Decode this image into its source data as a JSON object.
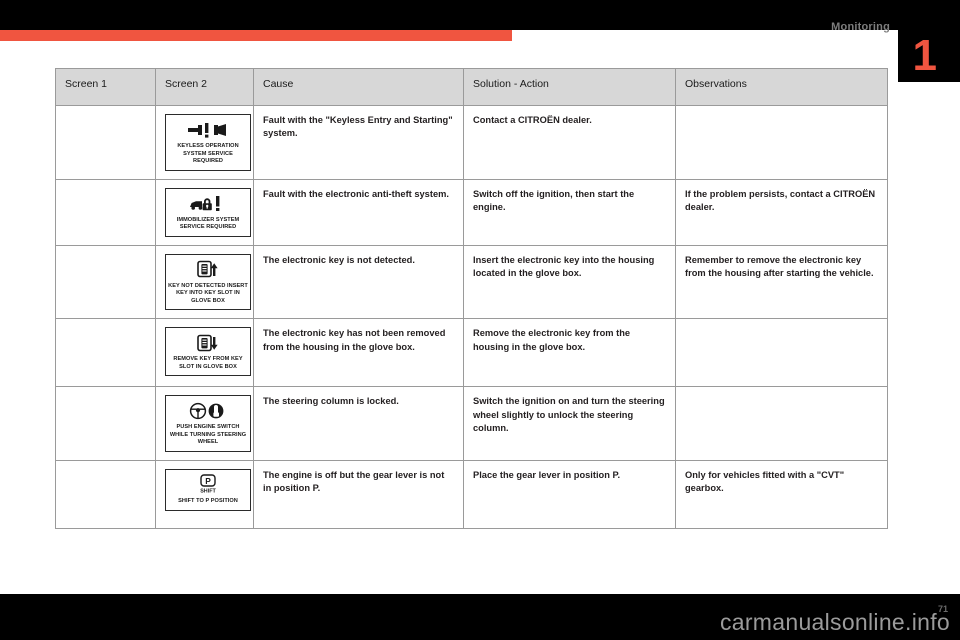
{
  "header": {
    "section_title": "Monitoring",
    "chapter_number": "1",
    "accent_color": "#f05540"
  },
  "footer": {
    "watermark": "carmanualsonline.info",
    "page_number": "71"
  },
  "table": {
    "columns": [
      "Screen 1",
      "Screen 2",
      "Cause",
      "Solution - Action",
      "Observations"
    ],
    "rows": [
      {
        "screen1": "",
        "screen2": {
          "icon": "key-exclamation-icon",
          "caption": "KEYLESS OPERATION SYSTEM SERVICE REQUIRED"
        },
        "cause": "Fault with the \"Keyless Entry and Starting\" system.",
        "solution": "Contact a CITROËN dealer.",
        "observations": ""
      },
      {
        "screen1": "",
        "screen2": {
          "icon": "car-lock-exclamation-icon",
          "caption": "IMMOBILIZER SYSTEM SERVICE REQUIRED"
        },
        "cause": "Fault with the electronic anti-theft system.",
        "solution": "Switch off the ignition, then start the engine.",
        "observations": "If the problem persists, contact a CITROËN dealer."
      },
      {
        "screen1": "",
        "screen2": {
          "icon": "key-slot-insert-icon",
          "caption": "KEY NOT DETECTED INSERT KEY INTO KEY SLOT IN GLOVE BOX"
        },
        "cause": "The electronic key is not detected.",
        "solution": "Insert the electronic key into the housing located in the glove box.",
        "observations": "Remember to remove the electronic key from the housing after starting the vehicle."
      },
      {
        "screen1": "",
        "screen2": {
          "icon": "key-slot-remove-icon",
          "caption": "REMOVE KEY FROM KEY SLOT IN GLOVE BOX"
        },
        "cause": "The electronic key has not been removed from the housing in the glove box.",
        "solution": "Remove the electronic key from the housing in the glove box.",
        "observations": ""
      },
      {
        "screen1": "",
        "screen2": {
          "icon": "steering-wheel-engine-switch-icon",
          "caption": "PUSH ENGINE SWITCH WHILE TURNING STEERING WHEEL"
        },
        "cause": "The steering column is locked.",
        "solution": "Switch the ignition on and turn the steering wheel slightly to unlock the steering column.",
        "observations": ""
      },
      {
        "screen1": "",
        "screen2": {
          "icon": "shift-to-park-icon",
          "caption": "SHIFT TO P POSITION"
        },
        "cause": "The engine is off but the gear lever is not in position P.",
        "solution": "Place the gear lever in position P.",
        "observations": "Only for vehicles fitted with a \"CVT\" gearbox."
      }
    ]
  }
}
